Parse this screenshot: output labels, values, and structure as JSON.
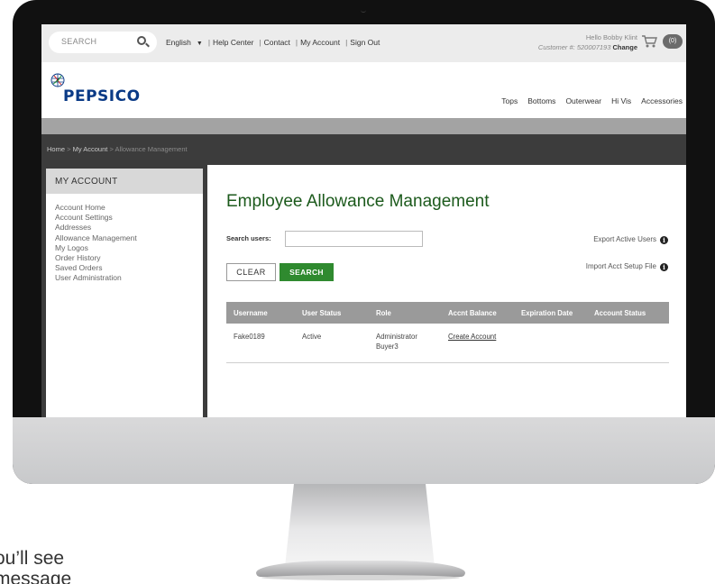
{
  "site": {
    "topbar": {
      "search_placeholder": "SEARCH",
      "language": "English",
      "links": [
        "Help Center",
        "Contact",
        "My Account",
        "Sign Out"
      ],
      "greeting": "Hello Bobby Klint",
      "customer_label": "Customer #: 520007193",
      "change_label": "Change",
      "cart_count": "(0)"
    },
    "header": {
      "logo_text": "PEPSICO",
      "nav": [
        "Tops",
        "Bottoms",
        "Outerwear",
        "Hi Vis",
        "Accessories"
      ]
    },
    "breadcrumb": {
      "home": "Home",
      "sep": ">",
      "account": "My Account",
      "current": "Allowance Management"
    },
    "sidebar": {
      "heading": "MY ACCOUNT",
      "items": [
        "Account Home",
        "Account Settings",
        "Addresses",
        "Allowance Management",
        "My Logos",
        "Order History",
        "Saved Orders",
        "User Administration"
      ]
    },
    "main": {
      "title": "Employee Allowance Management",
      "search_label": "Search users:",
      "search_value": "",
      "clear_label": "CLEAR",
      "search_button": "SEARCH",
      "export_label": "Export Active Users",
      "import_label": "Import Acct Setup File",
      "table": {
        "headers": [
          "Username",
          "User Status",
          "Role",
          "Accnt Balance",
          "Expiration Date",
          "Account Status"
        ],
        "rows": [
          {
            "username": "Fake0189",
            "status": "Active",
            "role_line1": "Administrator",
            "role_line2": "Buyer3",
            "balance": "Create Account",
            "expiration": "",
            "account_status": ""
          }
        ]
      }
    }
  },
  "caption": "ou’ll see\nmessage",
  "colors": {
    "title_green": "#1c5a1c",
    "button_green": "#2f8a2f",
    "logo_blue": "#0a3a86",
    "crumb_bar": "#3c3c3c",
    "table_header": "#9a9a9a"
  }
}
